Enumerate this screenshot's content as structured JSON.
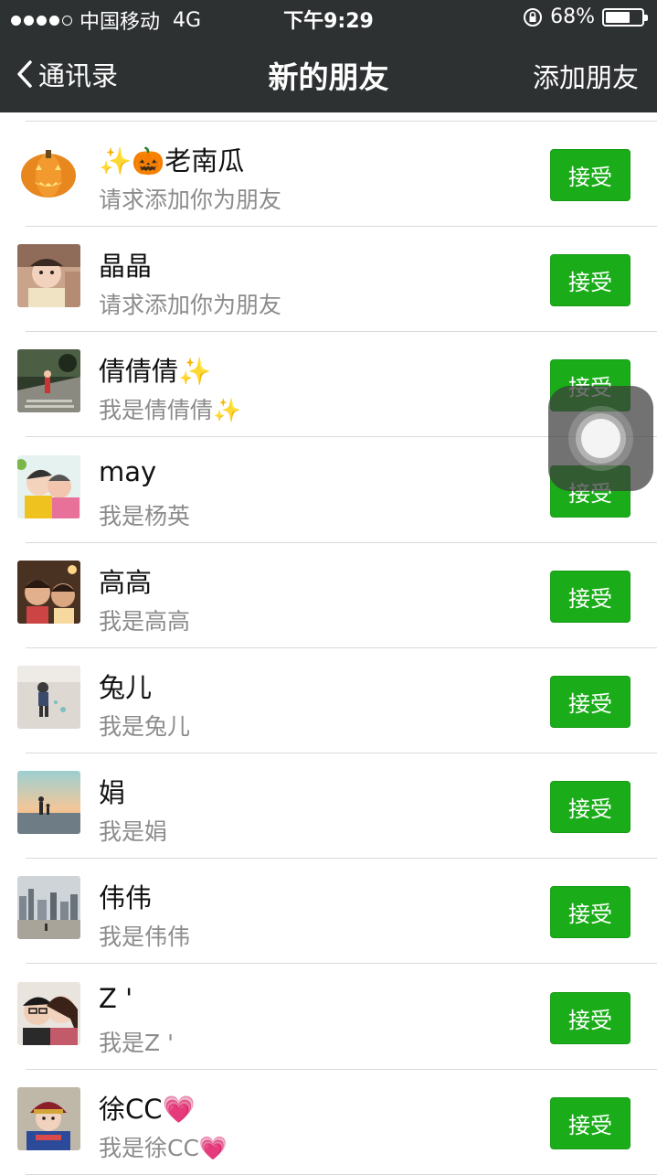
{
  "status_bar": {
    "carrier": "中国移动",
    "network": "4G",
    "time": "下午9:29",
    "battery_percent": "68%",
    "battery_level": 0.68
  },
  "nav": {
    "back_label": "通讯录",
    "title": "新的朋友",
    "action_label": "添加朋友"
  },
  "colors": {
    "nav_bg": "#2e3132",
    "accept_green": "#1aad19"
  },
  "requests": [
    {
      "name": "✨🎃老南瓜",
      "message": "请求添加你为朋友",
      "button": "接受",
      "avatar": "pumpkin-avatar"
    },
    {
      "name": "晶晶",
      "message": "请求添加你为朋友",
      "button": "接受",
      "avatar": "baby-photo-avatar"
    },
    {
      "name": "倩倩倩✨",
      "message": "我是倩倩倩✨",
      "button": "接受",
      "avatar": "park-photo-avatar"
    },
    {
      "name": "may",
      "message": "我是杨英",
      "button": "接受",
      "avatar": "kids-photo-avatar"
    },
    {
      "name": "高高",
      "message": "我是高高",
      "button": "接受",
      "avatar": "girls-photo-avatar"
    },
    {
      "name": "兔儿",
      "message": "我是兔儿",
      "button": "接受",
      "avatar": "child-walking-avatar"
    },
    {
      "name": "娟",
      "message": "我是娟",
      "button": "接受",
      "avatar": "sunset-beach-avatar"
    },
    {
      "name": "伟伟",
      "message": "我是伟伟",
      "button": "接受",
      "avatar": "city-skyline-avatar"
    },
    {
      "name": "Z '",
      "message": "我是Z '",
      "button": "接受",
      "avatar": "couple-selfie-avatar"
    },
    {
      "name": "徐CC💗",
      "message": "我是徐CC💗",
      "button": "接受",
      "avatar": "woman-hat-avatar"
    }
  ]
}
